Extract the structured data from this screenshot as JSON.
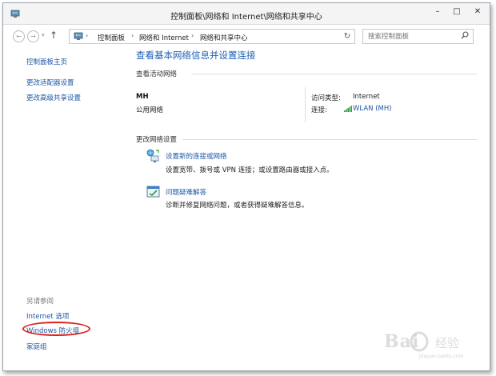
{
  "window": {
    "title": "控制面板\\网络和 Internet\\网络和共享中心",
    "minimize_glyph": "–",
    "maximize_glyph": "□",
    "close_glyph": "✕"
  },
  "nav": {
    "back_glyph": "←",
    "forward_glyph": "→",
    "recent_glyph": "▾",
    "up_glyph": "↑",
    "breadcrumb": [
      "控制面板",
      "网络和 Internet",
      "网络和共享中心"
    ],
    "breadcrumb_sep": "›",
    "dropdown_glyph": "∨",
    "refresh_glyph": "↻",
    "search_placeholder": "搜索控制面板"
  },
  "sidebar": {
    "links": [
      "控制面板主页",
      "更改适配器设置",
      "更改高级共享设置"
    ],
    "see_also_heading": "另请参阅",
    "see_also": [
      "Internet 选项",
      "Windows 防火墙",
      "家庭组"
    ]
  },
  "main": {
    "heading": "查看基本网络信息并设置连接",
    "active_networks_label": "查看活动网络",
    "network": {
      "name": "MH",
      "type": "公用网络",
      "access_type_label": "访问类型:",
      "access_type_value": "Internet",
      "connections_label": "连接:",
      "connection_value": "WLAN (MH)"
    },
    "change_settings_label": "更改网络设置",
    "tasks": [
      {
        "link": "设置新的连接或网络",
        "desc": "设置宽带、拨号或 VPN 连接；或设置路由器或接入点。",
        "icon": "new-connection-icon"
      },
      {
        "link": "问题疑难解答",
        "desc": "诊断并修复网络问题，或者获得疑难解答信息。",
        "icon": "troubleshoot-icon"
      }
    ]
  },
  "watermark": {
    "brand": "Bai",
    "sub": "经验",
    "url": "jingyan.baidu.com"
  },
  "colors": {
    "link": "#1d57a6",
    "heading": "#1d5fb3",
    "highlight": "#d9231f"
  }
}
